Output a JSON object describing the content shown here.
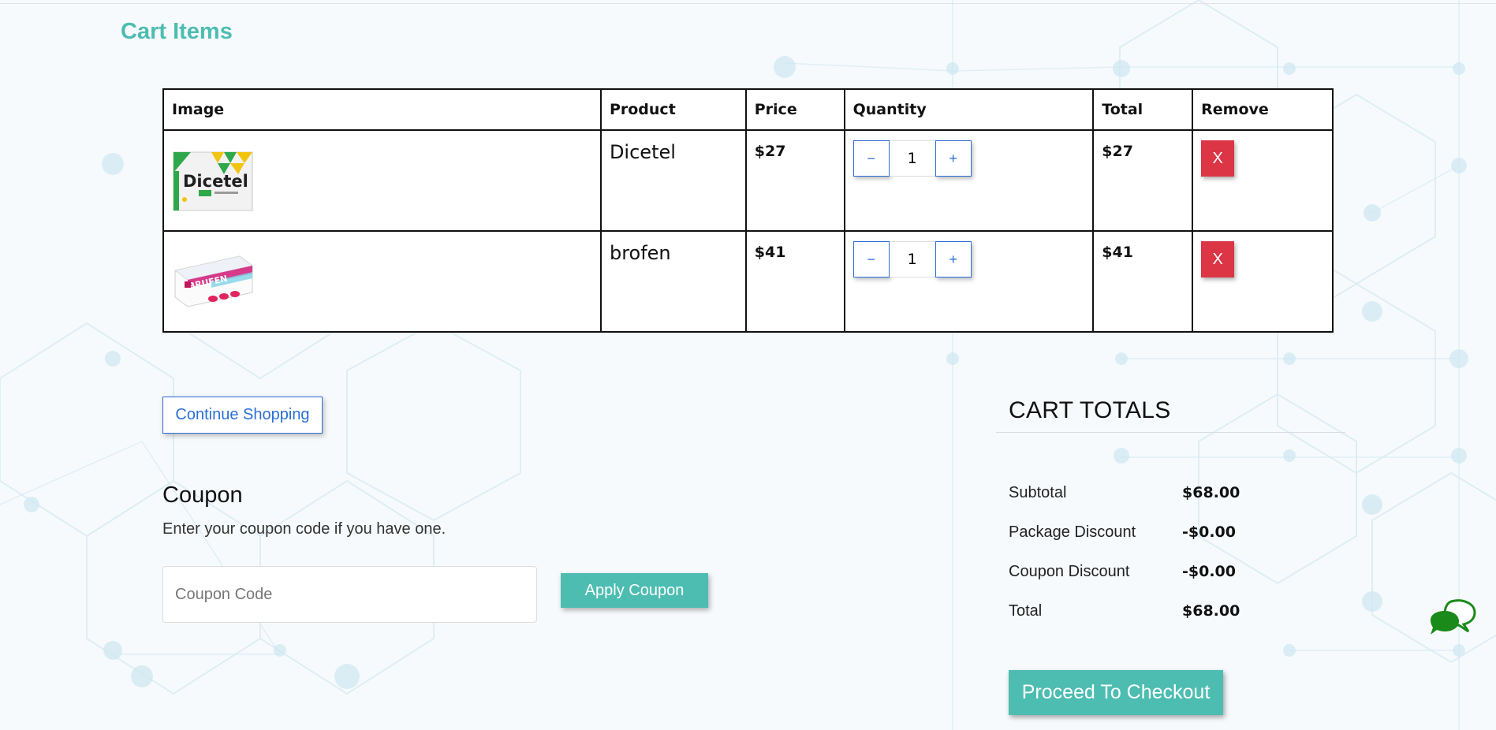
{
  "cart": {
    "section_title": "Cart Items",
    "columns": [
      "Image",
      "Product",
      "Price",
      "Quantity",
      "Total",
      "Remove"
    ],
    "items": [
      {
        "image_label": "Dicetel",
        "product": "Dicetel",
        "price": "$27",
        "quantity": "1",
        "total": "$27",
        "decrement": "−",
        "increment": "+",
        "remove": "X"
      },
      {
        "image_label": "BRUFEN",
        "product": "brofen",
        "price": "$41",
        "quantity": "1",
        "total": "$41",
        "decrement": "−",
        "increment": "+",
        "remove": "X"
      }
    ]
  },
  "continue_shopping": "Continue Shopping",
  "coupon": {
    "title": "Coupon",
    "description": "Enter your coupon code if you have one.",
    "placeholder": "Coupon Code",
    "apply": "Apply Coupon"
  },
  "totals": {
    "title": "CART TOTALS",
    "rows": [
      {
        "label": "Subtotal",
        "value": "$68.00"
      },
      {
        "label": "Package Discount",
        "value": "-$0.00"
      },
      {
        "label": "Coupon Discount",
        "value": "-$0.00"
      },
      {
        "label": "Total",
        "value": "$68.00"
      }
    ],
    "checkout": "Proceed To Checkout"
  },
  "icons": {
    "chat": "chat-bubbles-icon",
    "remove": "close-icon",
    "decrement": "minus-icon",
    "increment": "plus-icon"
  },
  "colors": {
    "accent": "#4dbdb2",
    "link_blue": "#2b6fd6",
    "danger": "#dc3545",
    "chat_green": "#1a8a1a"
  }
}
